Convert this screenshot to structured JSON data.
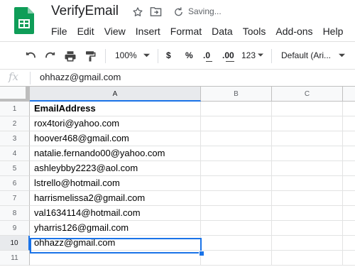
{
  "header": {
    "title": "VerifyEmail",
    "save_status": "Saving...",
    "brand_color": "#0f9d58"
  },
  "menu": [
    "File",
    "Edit",
    "View",
    "Insert",
    "Format",
    "Data",
    "Tools",
    "Add-ons",
    "Help"
  ],
  "toolbar": {
    "zoom": "100%",
    "currency": "$",
    "percent": "%",
    "decrease_decimals": ".0",
    "increase_decimals": ".00",
    "more_formats": "123",
    "font": "Default (Ari...",
    "icons": [
      "undo-icon",
      "redo-icon",
      "print-icon",
      "paint-format-icon"
    ]
  },
  "formula_bar": {
    "fx": "fx",
    "value": "ohhazz@gmail.com"
  },
  "grid": {
    "columns": [
      "A",
      "B",
      "C"
    ],
    "rows": [
      "1",
      "2",
      "3",
      "4",
      "5",
      "6",
      "7",
      "8",
      "9",
      "10",
      "11"
    ],
    "cells": [
      "EmailAddress",
      "rox4tori@yahoo.com",
      "hoover468@gmail.com",
      "natalie.fernando00@yahoo.com",
      "ashleybby2223@aol.com",
      "lstrello@hotmail.com",
      "harrismelissa2@gmail.com",
      "val1634114@hotmail.com",
      "yharris126@gmail.com",
      "ohhazz@gmail.com",
      ""
    ],
    "active_cell_row": "10",
    "active_cell_col": "A",
    "selection_color": "#1a73e8"
  }
}
